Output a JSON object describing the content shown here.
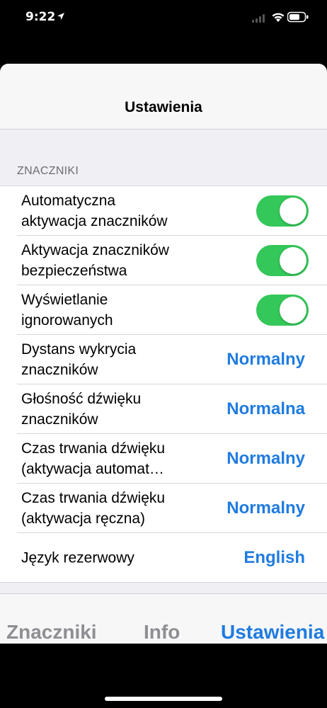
{
  "status_bar": {
    "time": "9:22"
  },
  "nav": {
    "title": "Ustawienia"
  },
  "section": {
    "header": "ZNACZNIKI"
  },
  "rows": [
    {
      "label": "Automatyczna\naktywacja znaczników",
      "control": "toggle",
      "on": true
    },
    {
      "label": "Aktywacja znaczników\nbezpieczeństwa",
      "control": "toggle",
      "on": true
    },
    {
      "label": "Wyświetlanie\nignorowanych",
      "control": "toggle",
      "on": true
    },
    {
      "label": "Dystans wykrycia\nznaczników",
      "control": "value",
      "value": "Normalny"
    },
    {
      "label": "Głośność dźwięku\nznaczników",
      "control": "value",
      "value": "Normalna"
    },
    {
      "label": "Czas trwania dźwięku\n(aktywacja automat…",
      "control": "value",
      "value": "Normalny"
    },
    {
      "label": "Czas trwania dźwięku\n(aktywacja ręczna)",
      "control": "value",
      "value": "Normalny"
    },
    {
      "label": "Język rezerwowy",
      "control": "value",
      "value": "English"
    }
  ],
  "tabs": [
    {
      "label": "Znaczniki",
      "active": false
    },
    {
      "label": "Info",
      "active": false
    },
    {
      "label": "Ustawienia",
      "active": true
    }
  ],
  "colors": {
    "accent": "#1f7be0",
    "toggle_on": "#34c759",
    "tab_inactive": "#8e8e93"
  },
  "icons": {
    "location": "location-arrow-icon",
    "signal": "cellular-signal-icon",
    "wifi": "wifi-icon",
    "battery": "battery-icon"
  }
}
